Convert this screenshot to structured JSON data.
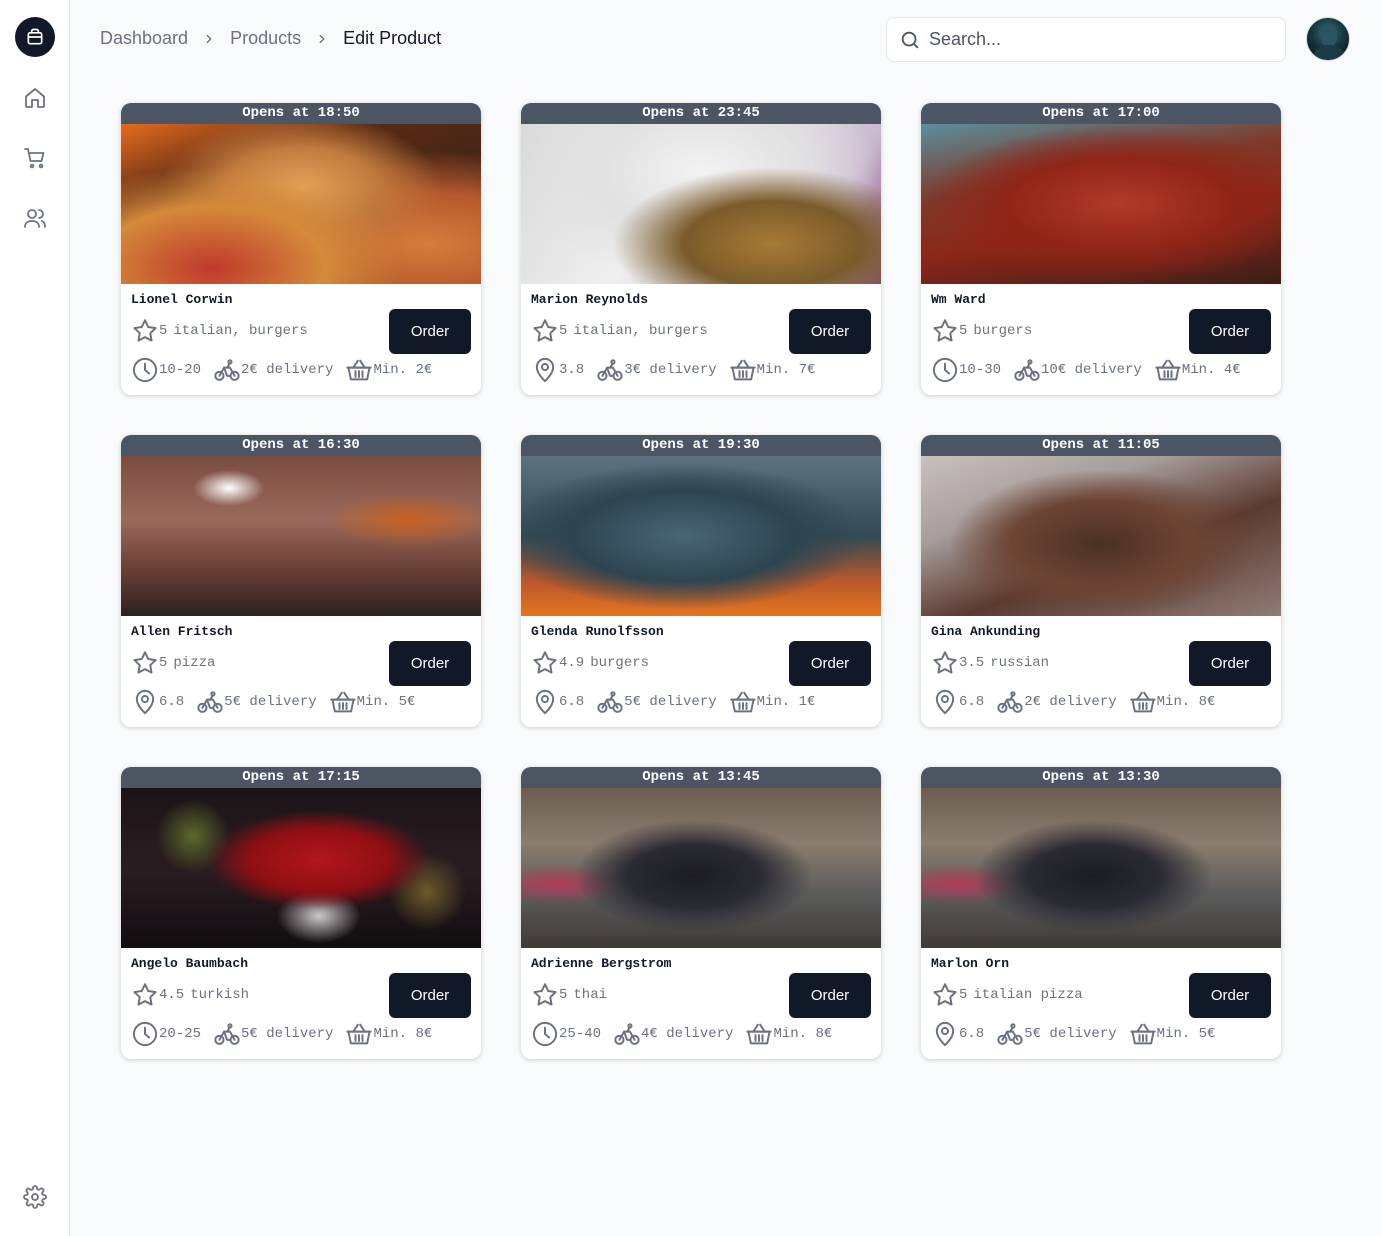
{
  "breadcrumb": [
    "Dashboard",
    "Products",
    "Edit Product"
  ],
  "search": {
    "placeholder": "Search..."
  },
  "sidebar": {
    "items": [
      {
        "icon": "home-icon"
      },
      {
        "icon": "cart-icon"
      },
      {
        "icon": "users-icon"
      }
    ],
    "settings_icon": "gear-icon"
  },
  "order_label": "Order",
  "cards": [
    {
      "opens": "Opens at 18:50",
      "name": "Lionel Corwin",
      "rating": "5",
      "tags": "italian, burgers",
      "meta_icon": "clock",
      "meta": "10-20",
      "delivery": "2€ delivery",
      "min": "Min. 2€",
      "photo": "pizza"
    },
    {
      "opens": "Opens at 23:45",
      "name": "Marion Reynolds",
      "rating": "5",
      "tags": "italian, burgers",
      "meta_icon": "pin",
      "meta": "3.8",
      "delivery": "3€ delivery",
      "min": "Min. 7€",
      "photo": "satay"
    },
    {
      "opens": "Opens at 17:00",
      "name": "Wm Ward",
      "rating": "5",
      "tags": "burgers",
      "meta_icon": "clock",
      "meta": "10-30",
      "delivery": "10€ delivery",
      "min": "Min. 4€",
      "photo": "menu"
    },
    {
      "opens": "Opens at 16:30",
      "name": "Allen Fritsch",
      "rating": "5",
      "tags": "pizza",
      "meta_icon": "pin",
      "meta": "6.8",
      "delivery": "5€ delivery",
      "min": "Min. 5€",
      "photo": "ceiling"
    },
    {
      "opens": "Opens at 19:30",
      "name": "Glenda Runolfsson",
      "rating": "4.9",
      "tags": "burgers",
      "meta_icon": "pin",
      "meta": "6.8",
      "delivery": "5€ delivery",
      "min": "Min. 1€",
      "photo": "spoon"
    },
    {
      "opens": "Opens at 11:05",
      "name": "Gina Ankunding",
      "rating": "3.5",
      "tags": "russian",
      "meta_icon": "pin",
      "meta": "6.8",
      "delivery": "2€ delivery",
      "min": "Min. 8€",
      "photo": "meat"
    },
    {
      "opens": "Opens at 17:15",
      "name": "Angelo Baumbach",
      "rating": "4.5",
      "tags": "turkish",
      "meta_icon": "clock",
      "meta": "20-25",
      "delivery": "5€ delivery",
      "min": "Min. 8€",
      "photo": "strawberry"
    },
    {
      "opens": "Opens at 13:45",
      "name": "Adrienne Bergstrom",
      "rating": "5",
      "tags": "thai",
      "meta_icon": "clock",
      "meta": "25-40",
      "delivery": "4€ delivery",
      "min": "Min. 8€",
      "photo": "cat"
    },
    {
      "opens": "Opens at 13:30",
      "name": "Marlon Orn",
      "rating": "5",
      "tags": "italian pizza",
      "meta_icon": "pin",
      "meta": "6.8",
      "delivery": "5€ delivery",
      "min": "Min. 5€",
      "photo": "cat"
    }
  ]
}
